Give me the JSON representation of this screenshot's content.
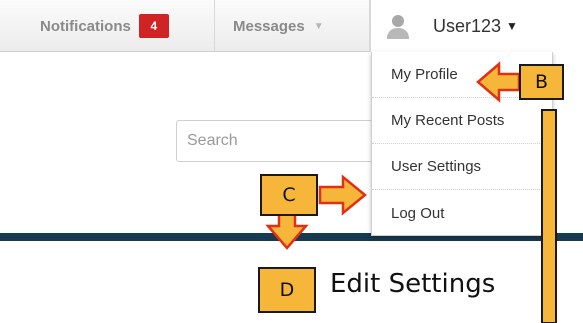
{
  "header": {
    "notifications_label": "Notifications",
    "notifications_count": "4",
    "messages_label": "Messages",
    "messages_caret": "▼",
    "username": "User123",
    "user_caret": "▼"
  },
  "search": {
    "placeholder": "Search"
  },
  "user_menu": {
    "items": [
      {
        "label": "My Profile"
      },
      {
        "label": "My Recent Posts"
      },
      {
        "label": "User Settings"
      },
      {
        "label": "Log Out"
      }
    ]
  },
  "annotations": {
    "callout_b": "B",
    "callout_c": "C",
    "callout_d": "D",
    "edit_settings_label": "Edit Settings"
  },
  "colors": {
    "badge": "#d02424",
    "callout_fill": "#f6b63a",
    "arrow_fill": "#f6b63a",
    "arrow_stroke": "#e32f12",
    "navy_band": "#163a52"
  },
  "icons": {
    "avatar": "user-avatar-icon",
    "caret": "chevron-down-icon"
  }
}
